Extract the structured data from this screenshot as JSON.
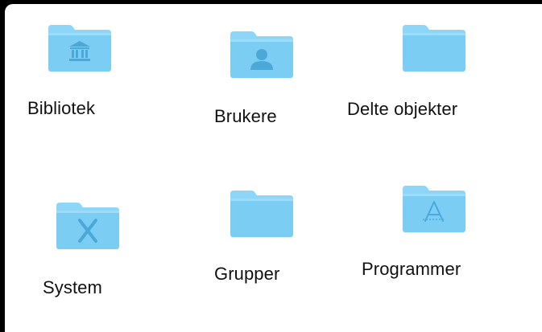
{
  "finder": {
    "items": [
      {
        "label": "Bibliotek",
        "icon": "library-folder-icon"
      },
      {
        "label": "Brukere",
        "icon": "users-folder-icon"
      },
      {
        "label": "Delte objekter",
        "icon": "shared-folder-icon"
      },
      {
        "label": "System",
        "icon": "system-folder-icon"
      },
      {
        "label": "Grupper",
        "icon": "folder-icon"
      },
      {
        "label": "Programmer",
        "icon": "applications-folder-icon"
      }
    ]
  },
  "colors": {
    "folder_body": "#7ccdf3",
    "folder_tab": "#8ed6f7",
    "folder_glyph": "#4aa9d9",
    "background": "#ffffff",
    "frame": "#000000",
    "text": "#111111"
  }
}
